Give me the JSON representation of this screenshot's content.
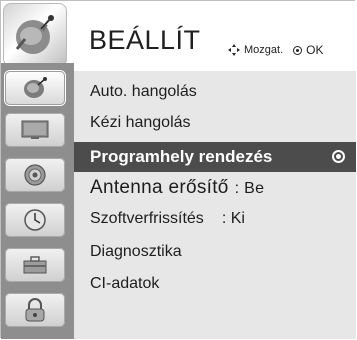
{
  "header": {
    "title": "BEÁLLÍT",
    "icon": "satellite-dish-icon",
    "hint_move": "Mozgat.",
    "hint_ok": "OK"
  },
  "sidebar": {
    "items": [
      {
        "icon": "satellite-dish-icon",
        "active": true
      },
      {
        "icon": "monitor-icon",
        "active": false
      },
      {
        "icon": "speaker-icon",
        "active": false
      },
      {
        "icon": "clock-icon",
        "active": false
      },
      {
        "icon": "toolbox-icon",
        "active": false
      },
      {
        "icon": "lock-icon",
        "active": false
      }
    ]
  },
  "menu": {
    "items": [
      {
        "label": "Auto. hangolás"
      },
      {
        "label": "Kézi hangolás"
      },
      {
        "label": "Programhely rendezés",
        "selected": true
      },
      {
        "label": "Antenna erősítő",
        "value": ": Be"
      },
      {
        "label": "Szoftverfrissítés",
        "value": ": Ki"
      },
      {
        "label": "Diagnosztika"
      },
      {
        "label": "CI-adatok"
      }
    ]
  },
  "colors": {
    "highlight": "#4c4c4c",
    "sidebar": "#8e8e8e",
    "list_bg": "#e7e7e7"
  }
}
